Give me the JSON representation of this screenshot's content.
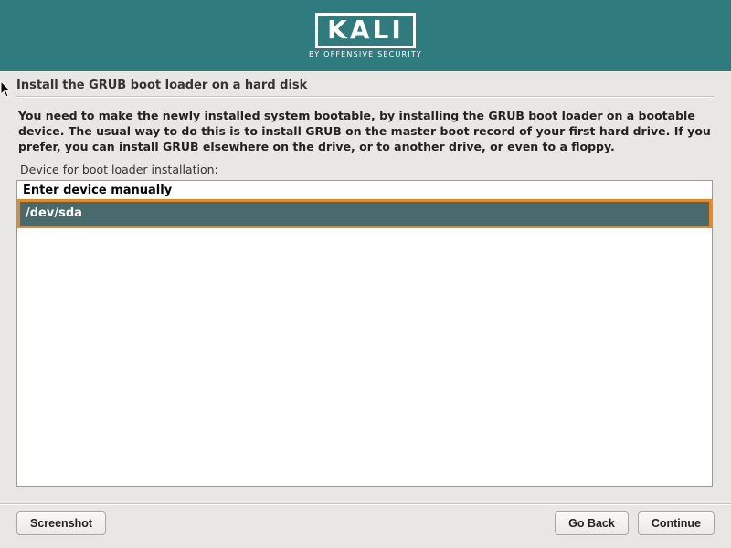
{
  "branding": {
    "name": "KALI",
    "subtitle": "BY OFFENSIVE SECURITY"
  },
  "page_title": "Install the GRUB boot loader on a hard disk",
  "instruction": "You need to make the newly installed system bootable, by installing the GRUB boot loader on a bootable device. The usual way to do this is to install GRUB on the master boot record of your first hard drive. If you prefer, you can install GRUB elsewhere on the drive, or to another drive, or even to a floppy.",
  "field_label": "Device for boot loader installation:",
  "options": [
    {
      "label": "Enter device manually",
      "selected": false
    },
    {
      "label": "/dev/sda",
      "selected": true
    }
  ],
  "buttons": {
    "screenshot": "Screenshot",
    "go_back": "Go Back",
    "continue": "Continue"
  },
  "colors": {
    "accent": "#2f7b7e",
    "highlight_border": "#e98820",
    "highlight_bg": "#486a6c"
  }
}
